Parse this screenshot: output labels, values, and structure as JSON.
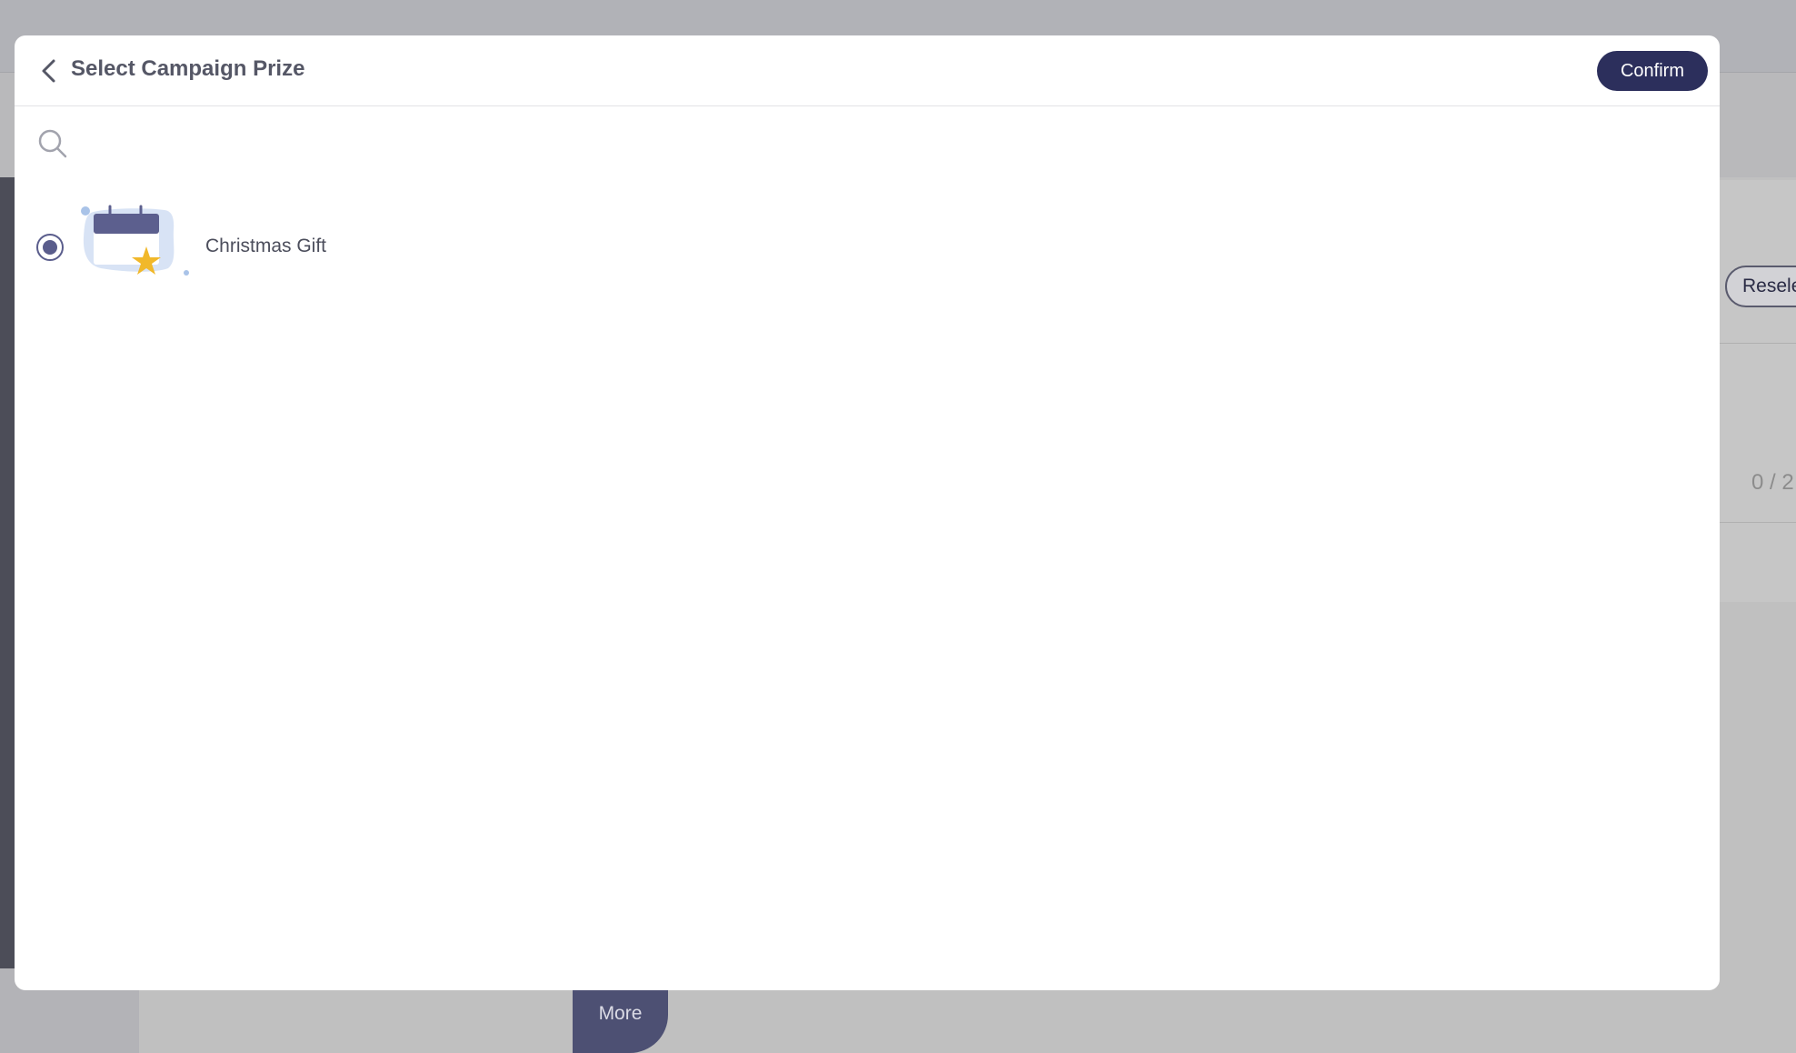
{
  "modal": {
    "title": "Select Campaign Prize",
    "confirm_label": "Confirm",
    "search": {
      "value": "",
      "placeholder": ""
    },
    "prizes": [
      {
        "name": "Christmas Gift",
        "selected": true,
        "icon": "calendar-star-icon"
      }
    ]
  },
  "background": {
    "reselect_label": "Reselect",
    "counter_text": "0 / 2",
    "more_label": "More"
  },
  "colors": {
    "primary": "#2c2f5c",
    "radio": "#5a5d8c",
    "overlay": "#b3b3b7"
  }
}
